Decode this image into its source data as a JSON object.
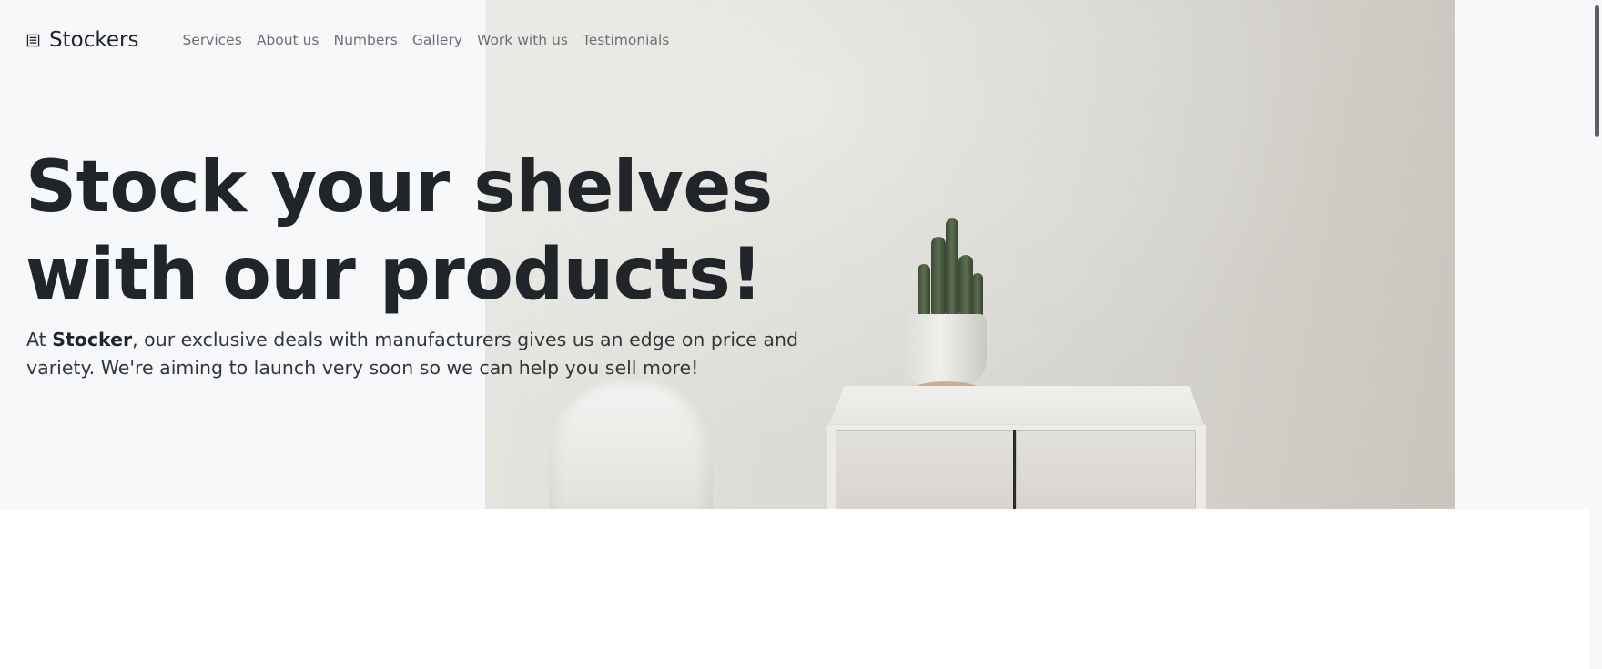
{
  "brand": {
    "icon": "building-icon",
    "name": "Stockers"
  },
  "nav": {
    "items": [
      {
        "label": "Services"
      },
      {
        "label": "About us"
      },
      {
        "label": "Numbers"
      },
      {
        "label": "Gallery"
      },
      {
        "label": "Work with us"
      },
      {
        "label": "Testimonials"
      }
    ]
  },
  "hero": {
    "headline_line1": "Stock your shelves",
    "headline_line2": "with our products!",
    "lead_prefix": "At ",
    "lead_brand": "Stocker",
    "lead_suffix": ", our exclusive deals with manufacturers gives us an edge on price and variety. We're aiming to launch very soon so we can help you sell more!"
  },
  "colors": {
    "hero_background": "#f7f8fa",
    "text_primary": "#212529",
    "nav_text": "#6c6f73"
  }
}
